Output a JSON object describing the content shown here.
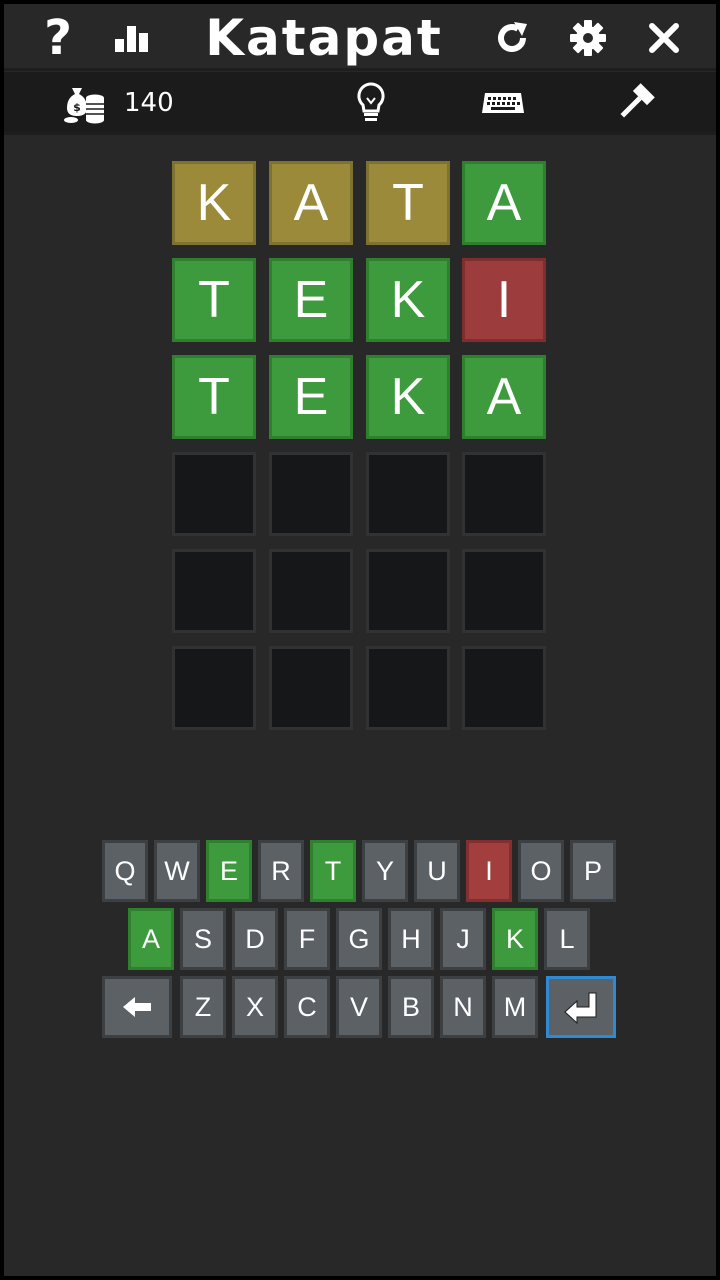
{
  "app": {
    "title": "Katapat"
  },
  "toolbar": {
    "coins": "140"
  },
  "colors": {
    "present": "#9a8a3a",
    "correct": "#3d9a3d",
    "absent": "#9c3c3c",
    "empty": "#161718",
    "key": "#5c6165",
    "enter_border": "#2f8ad3"
  },
  "board": {
    "rows": [
      [
        {
          "letter": "K",
          "state": "present"
        },
        {
          "letter": "A",
          "state": "present"
        },
        {
          "letter": "T",
          "state": "present"
        },
        {
          "letter": "A",
          "state": "correct"
        }
      ],
      [
        {
          "letter": "T",
          "state": "correct"
        },
        {
          "letter": "E",
          "state": "correct"
        },
        {
          "letter": "K",
          "state": "correct"
        },
        {
          "letter": "I",
          "state": "absent"
        }
      ],
      [
        {
          "letter": "T",
          "state": "correct"
        },
        {
          "letter": "E",
          "state": "correct"
        },
        {
          "letter": "K",
          "state": "correct"
        },
        {
          "letter": "A",
          "state": "correct"
        }
      ],
      [
        {
          "letter": "",
          "state": "empty"
        },
        {
          "letter": "",
          "state": "empty"
        },
        {
          "letter": "",
          "state": "empty"
        },
        {
          "letter": "",
          "state": "empty"
        }
      ],
      [
        {
          "letter": "",
          "state": "empty"
        },
        {
          "letter": "",
          "state": "empty"
        },
        {
          "letter": "",
          "state": "empty"
        },
        {
          "letter": "",
          "state": "empty"
        }
      ],
      [
        {
          "letter": "",
          "state": "empty"
        },
        {
          "letter": "",
          "state": "empty"
        },
        {
          "letter": "",
          "state": "empty"
        },
        {
          "letter": "",
          "state": "empty"
        }
      ]
    ]
  },
  "keyboard": {
    "rows": [
      [
        {
          "label": "Q",
          "state": "default"
        },
        {
          "label": "W",
          "state": "default"
        },
        {
          "label": "E",
          "state": "correct"
        },
        {
          "label": "R",
          "state": "default"
        },
        {
          "label": "T",
          "state": "correct"
        },
        {
          "label": "Y",
          "state": "default"
        },
        {
          "label": "U",
          "state": "default"
        },
        {
          "label": "I",
          "state": "absent"
        },
        {
          "label": "O",
          "state": "default"
        },
        {
          "label": "P",
          "state": "default"
        }
      ],
      [
        {
          "label": "A",
          "state": "correct"
        },
        {
          "label": "S",
          "state": "default"
        },
        {
          "label": "D",
          "state": "default"
        },
        {
          "label": "F",
          "state": "default"
        },
        {
          "label": "G",
          "state": "default"
        },
        {
          "label": "H",
          "state": "default"
        },
        {
          "label": "J",
          "state": "default"
        },
        {
          "label": "K",
          "state": "correct"
        },
        {
          "label": "L",
          "state": "default"
        }
      ],
      [
        {
          "label": "Z",
          "state": "default"
        },
        {
          "label": "X",
          "state": "default"
        },
        {
          "label": "C",
          "state": "default"
        },
        {
          "label": "V",
          "state": "default"
        },
        {
          "label": "B",
          "state": "default"
        },
        {
          "label": "N",
          "state": "default"
        },
        {
          "label": "M",
          "state": "default"
        }
      ]
    ],
    "backspace_icon": "backspace-arrow-icon",
    "enter_icon": "enter-return-icon"
  },
  "icons": {
    "help": "question-mark-icon",
    "stats": "bar-chart-icon",
    "restart": "restart-icon",
    "settings": "gear-icon",
    "close": "close-icon",
    "coins": "money-bag-coins-icon",
    "hint": "lightbulb-icon",
    "keyboard": "keyboard-icon",
    "hammer": "hammer-icon"
  }
}
